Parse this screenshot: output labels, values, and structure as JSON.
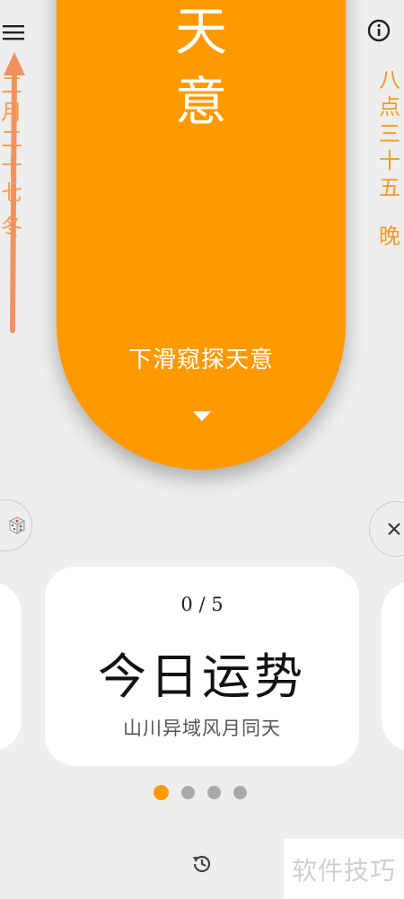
{
  "colors": {
    "accent": "#ff9900",
    "side_text": "#f3a04d",
    "background": "#eeeeee",
    "dot_inactive": "#a9a9a9",
    "annotation_arrow": "#f0905a"
  },
  "icons": {
    "menu": "menu-icon",
    "info": "info-icon",
    "dice": "dice-icon",
    "close": "close-icon",
    "caret": "caret-down-icon",
    "history": "history-icon"
  },
  "side_date": {
    "date": "二月二十七",
    "season": "冬"
  },
  "side_time": {
    "time": "八点三十五",
    "period": "晚"
  },
  "oracle": {
    "title": "天意",
    "hint": "下滑窥探天意"
  },
  "fortune_card": {
    "counter": "0 / 5",
    "title": "今日运势",
    "subtitle": "山川异域风月同天"
  },
  "pager": {
    "count": 4,
    "active_index": 0
  },
  "watermark": {
    "text": "软件技巧"
  }
}
